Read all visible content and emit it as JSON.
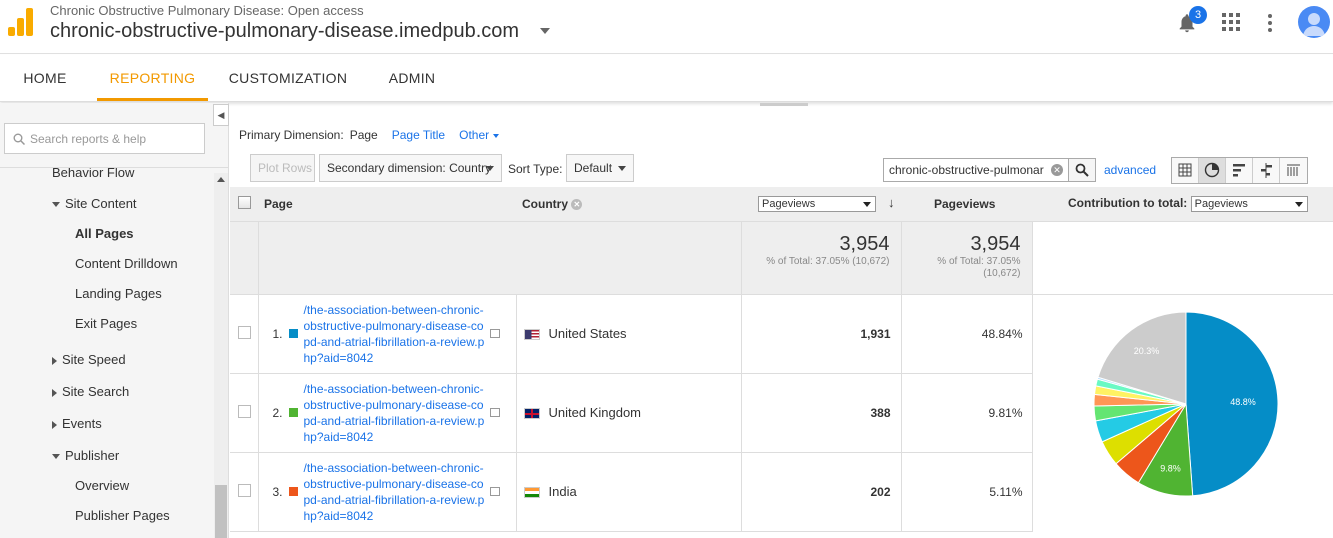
{
  "header": {
    "account": "Chronic Obstructive Pulmonary Disease: Open access",
    "property": "chronic-obstructive-pulmonary-disease.imedpub.com",
    "notifications": "3"
  },
  "nav": {
    "tabs": [
      "HOME",
      "REPORTING",
      "CUSTOMIZATION",
      "ADMIN"
    ],
    "active": "REPORTING"
  },
  "sidebar": {
    "search_placeholder": "Search reports & help",
    "items": [
      {
        "label": "Behavior Flow",
        "level": 1
      },
      {
        "label": "Site Content",
        "level": 1,
        "expanded": true
      },
      {
        "label": "All Pages",
        "level": 2,
        "active": true
      },
      {
        "label": "Content Drilldown",
        "level": 2
      },
      {
        "label": "Landing Pages",
        "level": 2
      },
      {
        "label": "Exit Pages",
        "level": 2
      },
      {
        "label": "Site Speed",
        "level": 1,
        "expanded": false
      },
      {
        "label": "Site Search",
        "level": 1,
        "expanded": false
      },
      {
        "label": "Events",
        "level": 1,
        "expanded": false
      },
      {
        "label": "Publisher",
        "level": 1,
        "expanded": true
      },
      {
        "label": "Overview",
        "level": 2
      },
      {
        "label": "Publisher Pages",
        "level": 2
      }
    ]
  },
  "toolbar": {
    "primary_dimension_label": "Primary Dimension:",
    "primary_current": "Page",
    "primary_link": "Page Title",
    "other": "Other",
    "plot_rows": "Plot Rows",
    "secondary_dimension": "Secondary dimension: Country",
    "sort_type_label": "Sort Type:",
    "sort_type": "Default",
    "filter_value": "chronic-obstructive-pulmonar",
    "advanced": "advanced"
  },
  "table": {
    "headers": {
      "page": "Page",
      "country": "Country",
      "metric_select": "Pageviews",
      "pageviews": "Pageviews",
      "contribution": "Contribution to total:",
      "contribution_select": "Pageviews"
    },
    "totals": {
      "value1": "3,954",
      "pct1": "% of Total: 37.05% (10,672)",
      "value2": "3,954",
      "pct2_a": "% of Total: 37.05%",
      "pct2_b": "(10,672)"
    },
    "rows": [
      {
        "index": "1.",
        "color": "#058dc7",
        "page": "/the-association-between-chronic-obstructive-pulmonary-disease-copd-and-atrial-fibrillation-a-review.php?aid=8042",
        "country": "United States",
        "pageviews": "1,931",
        "pct": "48.84%",
        "flag": "us"
      },
      {
        "index": "2.",
        "color": "#50b432",
        "page": "/the-association-between-chronic-obstructive-pulmonary-disease-copd-and-atrial-fibrillation-a-review.php?aid=8042",
        "country": "United Kingdom",
        "pageviews": "388",
        "pct": "9.81%",
        "flag": "uk"
      },
      {
        "index": "3.",
        "color": "#ed561b",
        "page": "/the-association-between-chronic-obstructive-pulmonary-disease-copd-and-atrial-fibrillation-a-review.php?aid=8042",
        "country": "India",
        "pageviews": "202",
        "pct": "5.11%",
        "flag": "in"
      }
    ]
  },
  "pie": {
    "slices": [
      {
        "value": 48.84,
        "color": "#058dc7",
        "label": "48.8%"
      },
      {
        "value": 9.81,
        "color": "#50b432",
        "label": "9.8%"
      },
      {
        "value": 5.11,
        "color": "#ed561b",
        "label": ""
      },
      {
        "value": 4.5,
        "color": "#dddf00",
        "label": ""
      },
      {
        "value": 3.8,
        "color": "#24cbe5",
        "label": ""
      },
      {
        "value": 2.6,
        "color": "#64e572",
        "label": ""
      },
      {
        "value": 2.0,
        "color": "#ff9655",
        "label": ""
      },
      {
        "value": 1.5,
        "color": "#fff263",
        "label": ""
      },
      {
        "value": 1.2,
        "color": "#6af9c4",
        "label": ""
      },
      {
        "value": 0.34,
        "color": "#b2deff",
        "label": ""
      },
      {
        "value": 20.3,
        "color": "#cccccc",
        "label": "20.3%"
      }
    ]
  }
}
